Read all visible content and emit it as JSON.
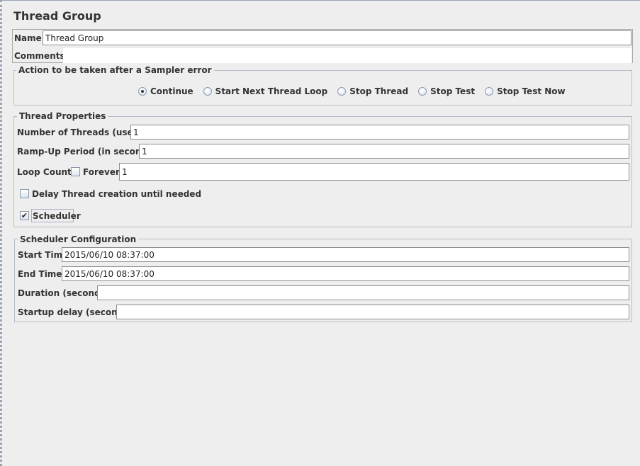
{
  "panel": {
    "title": "Thread Group",
    "name_label": "Name:",
    "name_value": "Thread Group",
    "comments_label": "Comments:",
    "comments_value": ""
  },
  "sampler_error": {
    "legend": "Action to be taken after a Sampler error",
    "options": [
      {
        "label": "Continue",
        "selected": true
      },
      {
        "label": "Start Next Thread Loop",
        "selected": false
      },
      {
        "label": "Stop Thread",
        "selected": false
      },
      {
        "label": "Stop Test",
        "selected": false
      },
      {
        "label": "Stop Test Now",
        "selected": false
      }
    ]
  },
  "thread_properties": {
    "legend": "Thread Properties",
    "threads_label": "Number of Threads (users):",
    "threads_value": "1",
    "rampup_label": "Ramp-Up Period (in seconds):",
    "rampup_value": "1",
    "loop_label": "Loop Count:",
    "forever_label": "Forever",
    "forever_checked": false,
    "loop_value": "1",
    "delay_label": "Delay Thread creation until needed",
    "delay_checked": false,
    "scheduler_label": "Scheduler",
    "scheduler_checked": true
  },
  "scheduler_config": {
    "legend": "Scheduler Configuration",
    "start_label": "Start Time",
    "start_value": "2015/06/10 08:37:00",
    "end_label": "End Time",
    "end_value": "2015/06/10 08:37:00",
    "duration_label": "Duration (seconds)",
    "duration_value": "",
    "delay_label": "Startup delay (seconds)",
    "delay_value": ""
  }
}
